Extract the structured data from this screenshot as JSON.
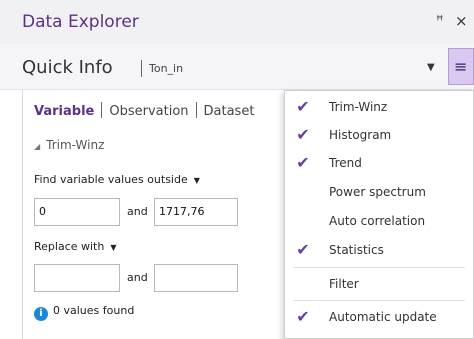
{
  "window": {
    "title": "Data Explorer",
    "pin_glyph": "ꟸ",
    "close_glyph": "×"
  },
  "quick_info": {
    "title": "Quick Info",
    "subtitle": "Ton_in",
    "caret_glyph": "▼",
    "menu_glyph": "≡"
  },
  "tabs": [
    {
      "label": "Variable",
      "active": true
    },
    {
      "label": "Observation",
      "active": false
    },
    {
      "label": "Dataset",
      "active": false
    }
  ],
  "section": {
    "title": "Trim-Winz",
    "tri_glyph": "◢"
  },
  "find": {
    "label": "Find variable values outside",
    "arrow": "▼",
    "low_value": "0",
    "and_label": "and",
    "high_value": "1717,76"
  },
  "replace": {
    "label": "Replace with",
    "arrow": "▼",
    "low_value": "",
    "and_label": "and",
    "high_value": ""
  },
  "status": {
    "icon": "info-icon",
    "icon_glyph": "i",
    "text": "0 values found"
  },
  "menu": {
    "check_glyph": "✔",
    "items": [
      {
        "label": "Trim-Winz",
        "checked": true
      },
      {
        "label": "Histogram",
        "checked": true
      },
      {
        "label": "Trend",
        "checked": true
      },
      {
        "label": "Power spectrum",
        "checked": false
      },
      {
        "label": "Auto correlation",
        "checked": false
      },
      {
        "label": "Statistics",
        "checked": true
      },
      {
        "label": "Filter",
        "checked": false
      },
      {
        "label": "Automatic update",
        "checked": true
      }
    ]
  },
  "colors": {
    "accent": "#5b3285",
    "check": "#6a3fa0",
    "menu_button": "#d9c8ef",
    "info": "#1e88d8"
  }
}
